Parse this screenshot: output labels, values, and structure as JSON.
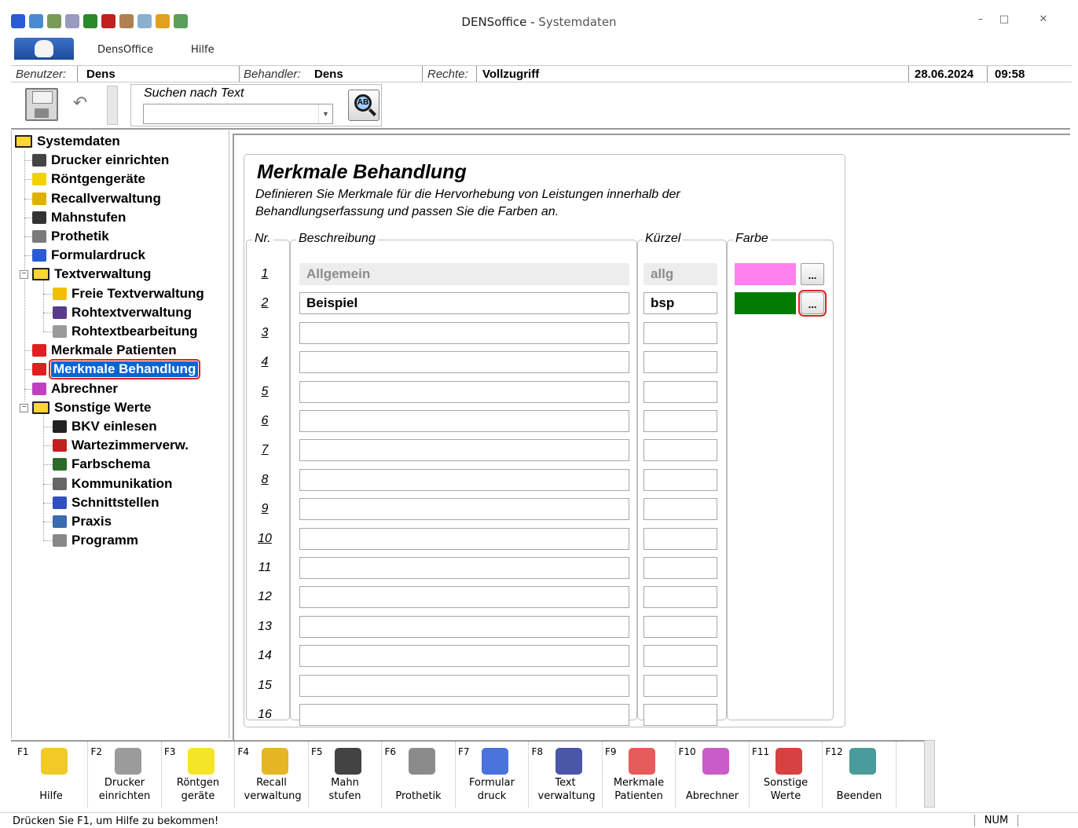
{
  "window": {
    "app_name": "DENSoffice - ",
    "section": "Systemdaten",
    "controls": {
      "minimize": "–",
      "maximize": "□",
      "close": "✕"
    }
  },
  "menu": {
    "items": [
      "DensOffice",
      "Hilfe"
    ]
  },
  "info": {
    "user_label": "Benutzer:",
    "user_value": "Dens",
    "treater_label": "Behandler:",
    "treater_value": "Dens",
    "rights_label": "Rechte:",
    "rights_value": "Vollzugriff",
    "date": "28.06.2024",
    "time": "09:58"
  },
  "toolbar": {
    "search_label": "Suchen nach Text",
    "undo_glyph": "↶",
    "search_button_glyph": "AB"
  },
  "tree": {
    "root": "Systemdaten",
    "items": [
      {
        "label": "Drucker einrichten",
        "icon": "printer-icon",
        "color": "#444444"
      },
      {
        "label": "Röntgengeräte",
        "icon": "radiation-icon",
        "color": "#f2d200"
      },
      {
        "label": "Recallverwaltung",
        "icon": "bell-icon",
        "color": "#e0b000"
      },
      {
        "label": "Mahnstufen",
        "icon": "stairs-icon",
        "color": "#333333"
      },
      {
        "label": "Prothetik",
        "icon": "document-icon",
        "color": "#7a7a7a"
      },
      {
        "label": "Formulardruck",
        "icon": "form-icon",
        "color": "#2a5bd7"
      }
    ],
    "textverwaltung": {
      "label": "Textverwaltung",
      "children": [
        {
          "label": "Freie Textverwaltung",
          "icon": "house-folder-icon",
          "color": "#f0c000"
        },
        {
          "label": "Rohtextverwaltung",
          "icon": "books-icon",
          "color": "#5a3a8a"
        },
        {
          "label": "Rohtextbearbeitung",
          "icon": "handshake-icon",
          "color": "#9a9a9a"
        }
      ]
    },
    "items2": [
      {
        "label": "Merkmale Patienten",
        "icon": "marker-icon",
        "color": "#e02020"
      },
      {
        "label": "Merkmale Behandlung",
        "icon": "marker-icon",
        "color": "#e02020"
      },
      {
        "label": "Abrechner",
        "icon": "dots-icon",
        "color": "#c040c0"
      }
    ],
    "sonstige": {
      "label": "Sonstige Werte",
      "children": [
        {
          "label": "BKV einlesen",
          "icon": "binder-icon",
          "color": "#222222"
        },
        {
          "label": "Wartezimmerverw.",
          "icon": "waiting-room-icon",
          "color": "#c02020"
        },
        {
          "label": "Farbschema",
          "icon": "color-bottles-icon",
          "color": "#2a6a2a"
        },
        {
          "label": "Kommunikation",
          "icon": "communication-icon",
          "color": "#666666"
        },
        {
          "label": "Schnittstellen",
          "icon": "interface-icon",
          "color": "#3050c0"
        },
        {
          "label": "Praxis",
          "icon": "building-icon",
          "color": "#3a6ab0"
        },
        {
          "label": "Programm",
          "icon": "gears-icon",
          "color": "#888888"
        }
      ]
    }
  },
  "form": {
    "title": "Merkmale Behandlung",
    "description": "Definieren Sie Merkmale für die Hervorhebung von Leistungen innerhalb der Behandlungserfassung und passen Sie die Farben an.",
    "columns": {
      "nr": "Nr.",
      "beschreibung": "Beschreibung",
      "kuerzel": "Kürzel",
      "farbe": "Farbe"
    },
    "color_button_label": "...",
    "rows": [
      {
        "nr": "1",
        "beschreibung": "Allgemein",
        "kuerzel": "allg",
        "color": "#ff80ee",
        "disabled": true
      },
      {
        "nr": "2",
        "beschreibung": "Beispiel",
        "kuerzel": "bsp",
        "color": "#007a00",
        "disabled": false
      },
      {
        "nr": "3",
        "beschreibung": "",
        "kuerzel": ""
      },
      {
        "nr": "4",
        "beschreibung": "",
        "kuerzel": ""
      },
      {
        "nr": "5",
        "beschreibung": "",
        "kuerzel": ""
      },
      {
        "nr": "6",
        "beschreibung": "",
        "kuerzel": ""
      },
      {
        "nr": "7",
        "beschreibung": "",
        "kuerzel": ""
      },
      {
        "nr": "8",
        "beschreibung": "",
        "kuerzel": ""
      },
      {
        "nr": "9",
        "beschreibung": "",
        "kuerzel": ""
      },
      {
        "nr": "10",
        "beschreibung": "",
        "kuerzel": ""
      },
      {
        "nr": "11",
        "beschreibung": "",
        "kuerzel": ""
      },
      {
        "nr": "12",
        "beschreibung": "",
        "kuerzel": ""
      },
      {
        "nr": "13",
        "beschreibung": "",
        "kuerzel": ""
      },
      {
        "nr": "14",
        "beschreibung": "",
        "kuerzel": ""
      },
      {
        "nr": "15",
        "beschreibung": "",
        "kuerzel": ""
      },
      {
        "nr": "16",
        "beschreibung": "",
        "kuerzel": ""
      }
    ]
  },
  "fkeys": [
    {
      "key": "F1",
      "label": "Hilfe",
      "icon": "help-icon",
      "color": "#f0c000"
    },
    {
      "key": "F2",
      "label": "Drucker einrichten",
      "icon": "printer-icon",
      "color": "#8a8a8a"
    },
    {
      "key": "F3",
      "label": "Röntgen geräte",
      "icon": "radiation-icon",
      "color": "#f2e000"
    },
    {
      "key": "F4",
      "label": "Recall verwaltung",
      "icon": "bell-icon",
      "color": "#e0a800"
    },
    {
      "key": "F5",
      "label": "Mahn stufen",
      "icon": "stairs-icon",
      "color": "#222222"
    },
    {
      "key": "F6",
      "label": "Prothetik",
      "icon": "document-icon",
      "color": "#777777"
    },
    {
      "key": "F7",
      "label": "Formular druck",
      "icon": "form-icon",
      "color": "#2a5bd7"
    },
    {
      "key": "F8",
      "label": "Text verwaltung",
      "icon": "books-icon",
      "color": "#2a3a9a"
    },
    {
      "key": "F9",
      "label": "Merkmale Patienten",
      "icon": "marker-icon",
      "color": "#e04040"
    },
    {
      "key": "F10",
      "label": "Abrechner",
      "icon": "dots-icon",
      "color": "#c040c0"
    },
    {
      "key": "F11",
      "label": "Sonstige Werte",
      "icon": "cubes-icon",
      "color": "#d02020"
    },
    {
      "key": "F12",
      "label": "Beenden",
      "icon": "exit-door-icon",
      "color": "#2a8a8a"
    }
  ],
  "status": {
    "text": "Drücken Sie F1, um Hilfe zu bekommen!",
    "num": "NUM"
  }
}
